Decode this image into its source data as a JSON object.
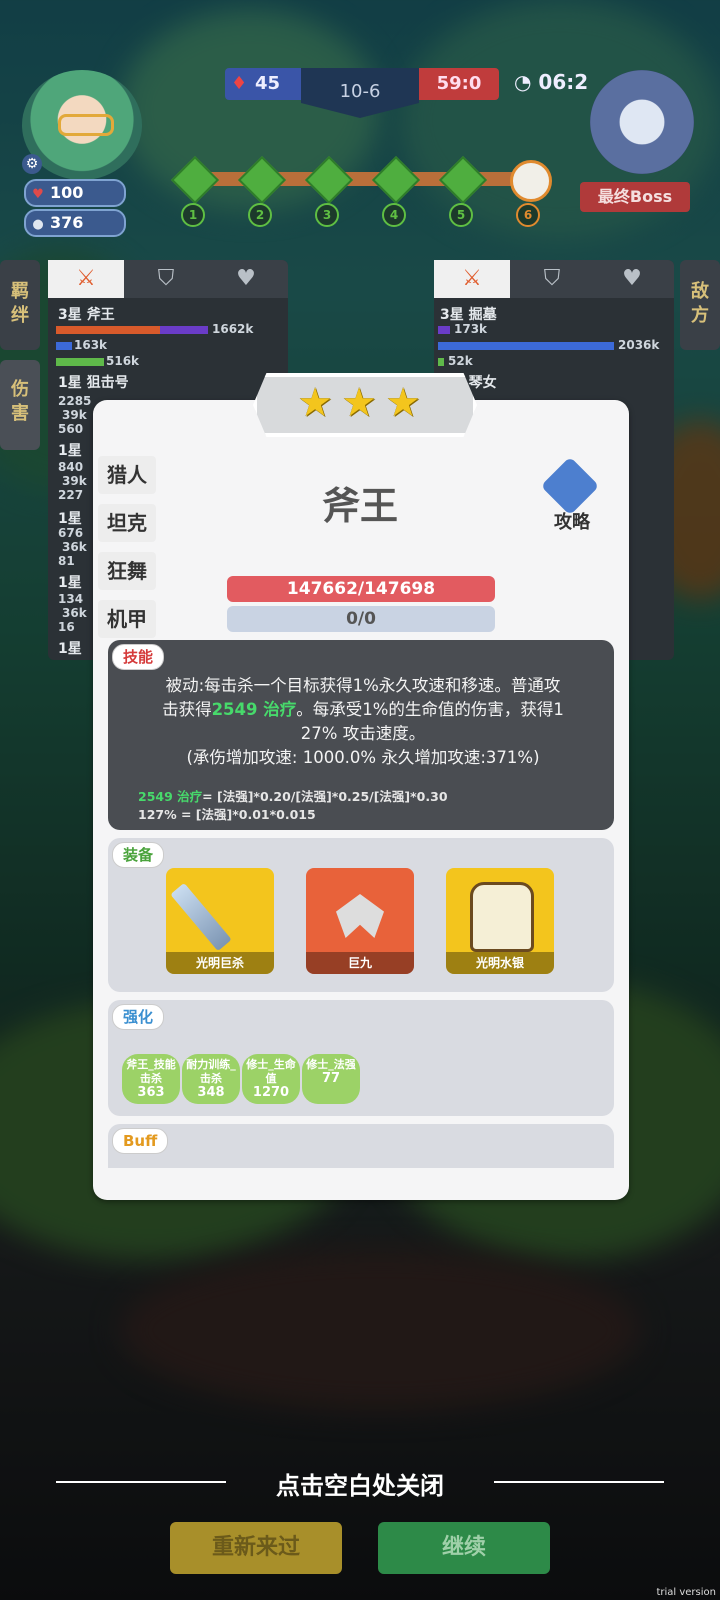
{
  "hud": {
    "kills": "45",
    "stage": "10-6",
    "score": "59:0",
    "timer": "06:2",
    "player": {
      "hp": "100",
      "coins": "376"
    },
    "progress_nodes": [
      "1",
      "2",
      "3",
      "4",
      "5",
      "6"
    ],
    "boss_label": "最终Boss"
  },
  "left_panel": {
    "side_tabs": [
      "羁绊",
      "伤害"
    ],
    "rows": [
      {
        "name": "3星 斧王",
        "v1": "1662k",
        "v2": "163k",
        "v3": "516k"
      },
      {
        "name": "1星 狙击号",
        "v1": "2285",
        "v2": "39k",
        "v3": "560"
      },
      {
        "name": "1星",
        "v1": "840",
        "v2": "39k",
        "v3": "227"
      },
      {
        "name": "1星",
        "v1": "676",
        "v2": "36k",
        "v3": "81"
      },
      {
        "name": "1星",
        "v1": "134",
        "v2": "36k",
        "v3": "16"
      },
      {
        "name": "1星",
        "v1": "",
        "v2": "",
        "v3": ""
      }
    ]
  },
  "right_panel": {
    "side_tab": "敌方",
    "rows": [
      {
        "name": "3星 掘墓",
        "v1": "173k",
        "v2": "2036k",
        "v3": "52k"
      },
      {
        "name": "1星 琴女",
        "v1": "",
        "v2": "",
        "v3": ""
      }
    ]
  },
  "modal": {
    "stars": 3,
    "classes": [
      "猎人",
      "坦克",
      "狂舞",
      "机甲"
    ],
    "hero_name": "斧王",
    "guide_label": "攻略",
    "hp_text": "147662/147698",
    "mp_text": "0/0",
    "skill": {
      "tag": "技能",
      "line1": "被动:每击杀一个目标获得1%永久攻速和移速。普通攻",
      "line2a": "击获得",
      "line2b": "2549 治疗",
      "line2c": "。每承受1%的生命值的伤害，获得1",
      "line3": "27% 攻击速度。",
      "line4": "(承伤增加攻速: 1000.0% 永久增加攻速:371%)",
      "formula1a": "2549 治疗",
      "formula1b": "= [法强]*0.20/[法强]*0.25/[法强]*0.30",
      "formula2": "127% = [法强]*0.01*0.015"
    },
    "equipment": {
      "tag": "装备",
      "items": [
        {
          "name": "光明巨杀",
          "icon": "sword-icon"
        },
        {
          "name": "巨九",
          "icon": "axe-icon"
        },
        {
          "name": "光明水银",
          "icon": "armor-icon"
        }
      ]
    },
    "enhance": {
      "tag": "强化",
      "items": [
        {
          "name": "斧王_技能击杀",
          "value": "363"
        },
        {
          "name": "耐力训练_击杀",
          "value": "348"
        },
        {
          "name": "修士_生命值",
          "value": "1270"
        },
        {
          "name": "修士_法强",
          "value": "77"
        }
      ]
    },
    "buff": {
      "tag": "Buff"
    }
  },
  "close_hint": "点击空白处关闭",
  "buttons": {
    "restart": "重新来过",
    "continue": "继续"
  },
  "watermark": "trial version",
  "colors": {
    "accent_red": "#e25b60",
    "heal_green": "#47d96b",
    "star": "#f3c51d"
  }
}
